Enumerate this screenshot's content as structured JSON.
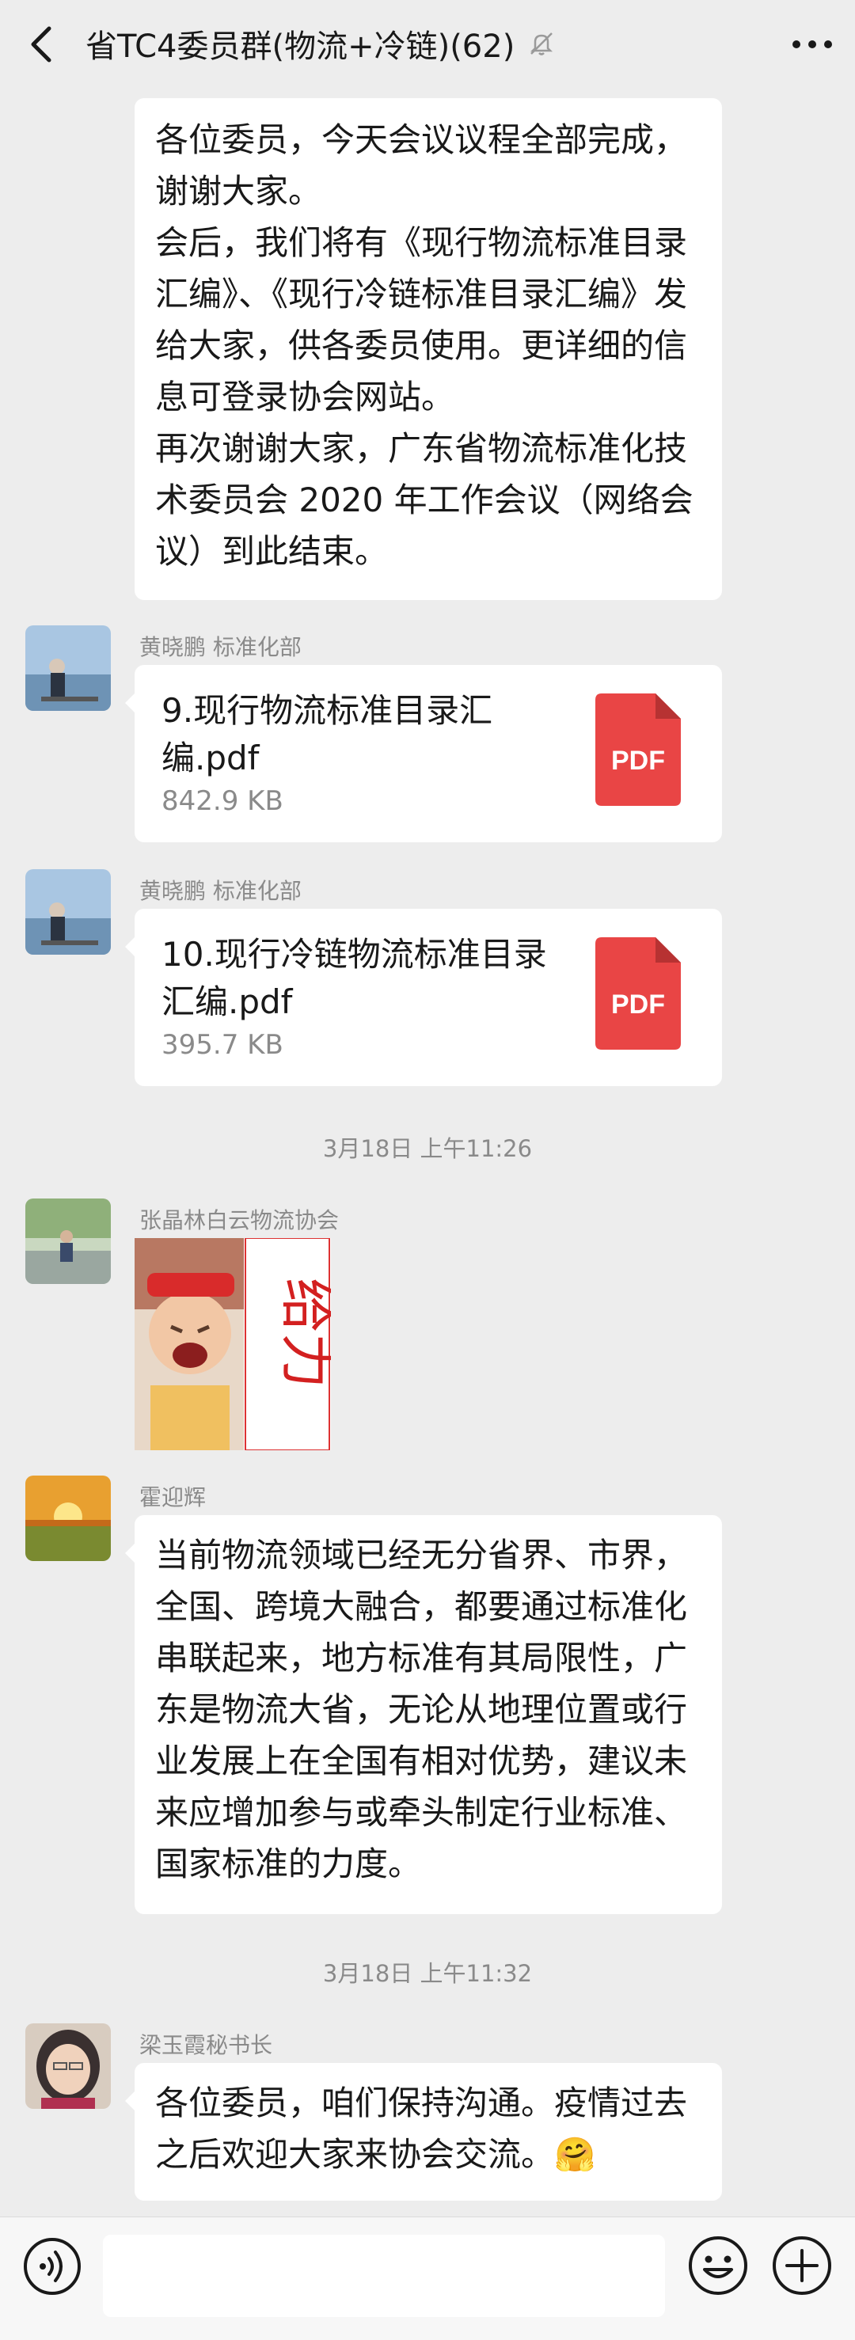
{
  "header": {
    "title": "省TC4委员群(物流+冷链)(62)",
    "back_icon": "chevron-left-icon",
    "mute_icon": "bell-off-icon",
    "more_icon": "more-horizontal-icon"
  },
  "messages": {
    "m1": {
      "paragraphs": [
        "各位委员，今天会议议程全部完成，谢谢大家。",
        "会后，我们将有《现行物流标准目录汇编》、《现行冷链标准目录汇编》发给大家，供各委员使用。更详细的信息可登录协会网站。",
        "再次谢谢大家，广东省物流标准化技术委员会 2020 年工作会议（网络会议）到此结束。"
      ]
    },
    "m2": {
      "sender": "黄晓鹏 标准化部",
      "file_name": "9.现行物流标准目录汇编.pdf",
      "file_size": "842.9 KB",
      "file_type": "PDF"
    },
    "m3": {
      "sender": "黄晓鹏 标准化部",
      "file_name": "10.现行冷链物流标准目录汇编.pdf",
      "file_size": "395.7 KB",
      "file_type": "PDF"
    },
    "ts1": "3月18日 上午11:26",
    "m4": {
      "sender": "张晶林白云物流协会",
      "sticker_text": "给力"
    },
    "m5": {
      "sender": "霍迎辉",
      "text": "当前物流领域已经无分省界、市界，全国、跨境大融合，都要通过标准化串联起来，地方标准有其局限性，广东是物流大省，无论从地理位置或行业发展上在全国有相对优势，建议未来应增加参与或牵头制定行业标准、国家标准的力度。"
    },
    "ts2": "3月18日 上午11:32",
    "m6": {
      "sender": "梁玉霞秘书长",
      "text": "各位委员，咱们保持沟通。疫情过去之后欢迎大家来协会交流。",
      "emoji": "🤗"
    }
  },
  "input_bar": {
    "placeholder": "",
    "voice_icon": "voice-icon",
    "emoji_icon": "smile-icon",
    "plus_icon": "plus-circle-icon"
  },
  "colors": {
    "background": "#ededed",
    "bubble": "#ffffff",
    "pdf_red": "#e94545",
    "meta_text": "#8a8a8a"
  }
}
